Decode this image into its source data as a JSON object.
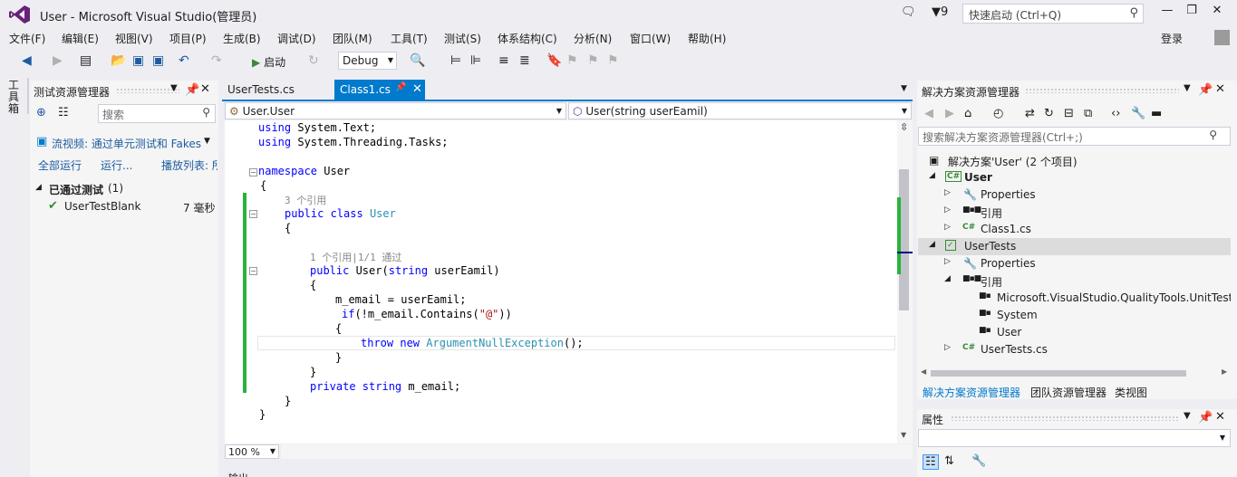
{
  "window": {
    "title": "User - Microsoft Visual Studio(管理员)",
    "notification_count": "9",
    "quick_launch_placeholder": "快速启动 (Ctrl+Q)",
    "login": "登录"
  },
  "menu": [
    "文件(F)",
    "编辑(E)",
    "视图(V)",
    "项目(P)",
    "生成(B)",
    "调试(D)",
    "团队(M)",
    "工具(T)",
    "测试(S)",
    "体系结构(C)",
    "分析(N)",
    "窗口(W)",
    "帮助(H)"
  ],
  "toolbar": {
    "run_label": "启动",
    "config": "Debug"
  },
  "toolbox_label": "工具箱",
  "test_explorer": {
    "title": "测试资源管理器",
    "search_placeholder": "搜索",
    "stream_text": "流视频: 通过单元测试和 Fakes",
    "run_all": "全部运行",
    "run": "运行...",
    "playlist": "播放列表: 所",
    "group_label": "已通过测试",
    "group_count": "(1)",
    "test_name": "UserTestBlank",
    "test_time": "7 毫秒"
  },
  "editor": {
    "tabs": [
      "UserTests.cs",
      "Class1.cs"
    ],
    "nav_left": "User.User",
    "nav_right": "User(string userEamil)",
    "zoom": "100 %",
    "lines": {
      "l1a": "using",
      "l1b": " System.Text;",
      "l2a": "using",
      "l2b": " System.Threading.Tasks;",
      "l3a": "namespace",
      "l3b": " User",
      "l4": "{",
      "hint1": "3 个引用",
      "l5a": "public class",
      "l5b": "User",
      "l6": "{",
      "hint2": "1 个引用|1/1 通过",
      "l7a": "public",
      "l7b": " User(",
      "l7c": "string",
      "l7d": " userEamil)",
      "l8": "{",
      "l9": "m_email = userEamil;",
      "l10a": "if",
      "l10b": "(!m_email.Contains(",
      "l10c": "\"@\"",
      "l10d": "))",
      "l11": "{",
      "l12a": "throw new",
      "l12b": "ArgumentNullException",
      "l12c": "();",
      "l13": "}",
      "l14": "}",
      "l15a": "private string",
      "l15b": " m_email;",
      "l16": "}",
      "l17": "}"
    }
  },
  "output_title": "输出",
  "solution_explorer": {
    "title": "解决方案资源管理器",
    "search_placeholder": "搜索解决方案资源管理器(Ctrl+;)",
    "solution": "解决方案'User' (2 个项目)",
    "items": [
      "User",
      "Properties",
      "引用",
      "Class1.cs",
      "UserTests",
      "Properties",
      "引用",
      "Microsoft.VisualStudio.QualityTools.UnitTestF",
      "System",
      "User",
      "UserTests.cs"
    ],
    "tabs": [
      "解决方案资源管理器",
      "团队资源管理器",
      "类视图"
    ]
  },
  "properties": {
    "title": "属性"
  }
}
